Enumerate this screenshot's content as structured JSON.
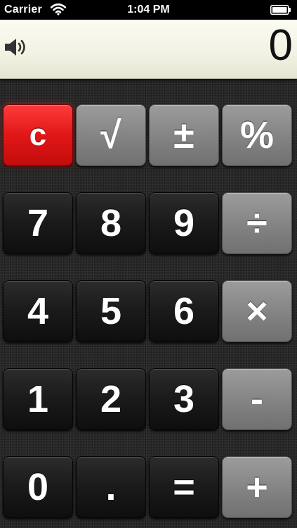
{
  "status_bar": {
    "carrier": "Carrier",
    "time": "1:04 PM",
    "icons": [
      "wifi-icon",
      "battery-icon"
    ]
  },
  "display": {
    "value": "0",
    "speaker_icon": "speaker-icon"
  },
  "colors": {
    "clear_key": "#e01717",
    "operator_key": "#858585",
    "number_key": "#1a1a1a",
    "display_bg": "#f2f2e3"
  },
  "keys": {
    "clear": "c",
    "sqrt": "√",
    "plus_minus": "±",
    "percent": "%",
    "seven": "7",
    "eight": "8",
    "nine": "9",
    "divide": "÷",
    "four": "4",
    "five": "5",
    "six": "6",
    "multiply": "×",
    "one": "1",
    "two": "2",
    "three": "3",
    "minus": "-",
    "zero": "0",
    "decimal": ".",
    "equals": "=",
    "plus": "+"
  }
}
